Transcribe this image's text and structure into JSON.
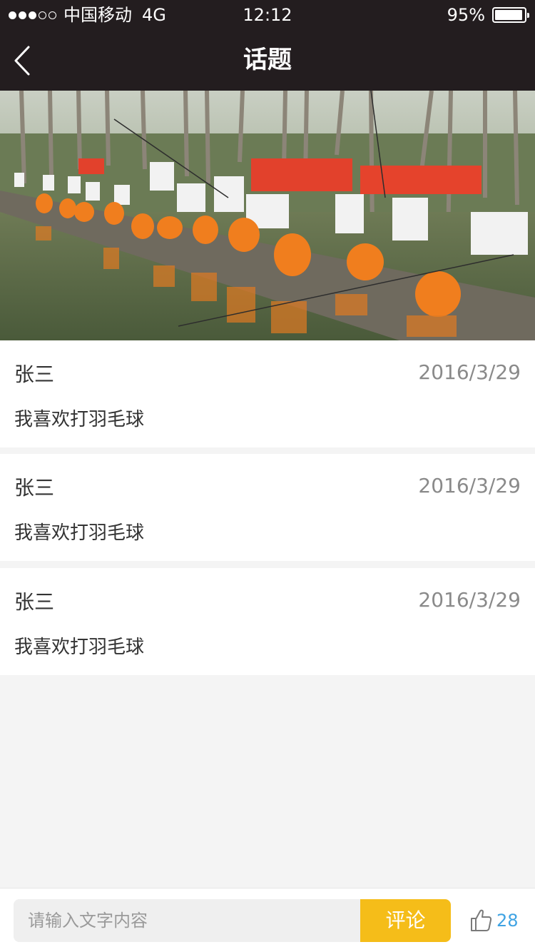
{
  "status_bar": {
    "carrier": "中国移动",
    "network": "4G",
    "time": "12:12",
    "battery": "95%",
    "battery_level": 0.95,
    "signal_strength": 3
  },
  "nav": {
    "title": "话题",
    "back_icon": "chevron-left-icon"
  },
  "comments": [
    {
      "author": "张三",
      "date": "2016/3/29",
      "text": "我喜欢打羽毛球"
    },
    {
      "author": "张三",
      "date": "2016/3/29",
      "text": "我喜欢打羽毛球"
    },
    {
      "author": "张三",
      "date": "2016/3/29",
      "text": "我喜欢打羽毛球"
    }
  ],
  "bottom_bar": {
    "input_placeholder": "请输入文字内容",
    "submit_label": "评论",
    "like_icon": "thumbs-up-icon",
    "like_count": "28"
  },
  "colors": {
    "header_bg": "#231d1f",
    "accent": "#f5bd19",
    "like_blue": "#3fa3e3",
    "page_bg": "#f4f4f4"
  }
}
